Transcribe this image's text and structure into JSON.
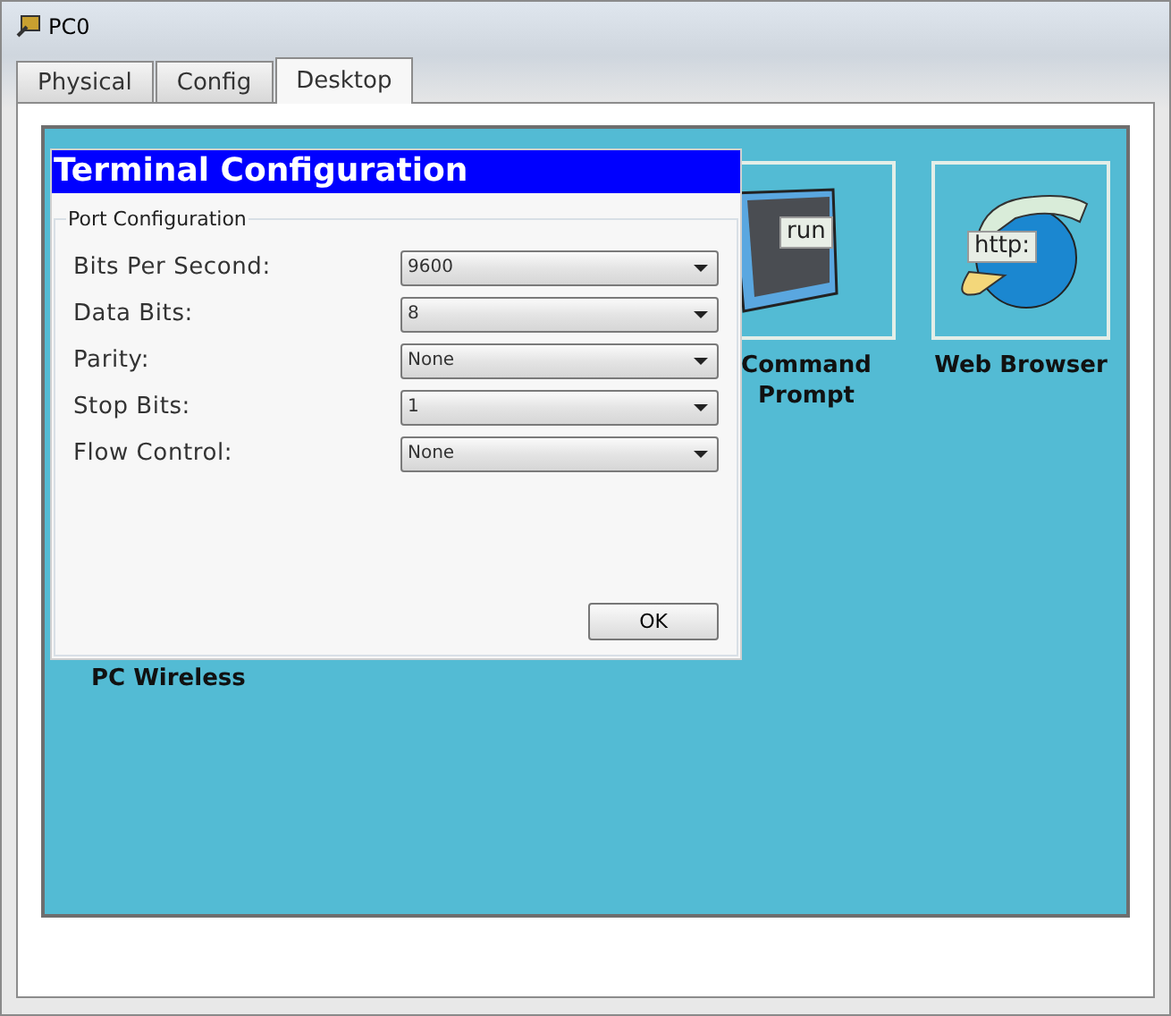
{
  "window": {
    "title": "PC0"
  },
  "tabs": [
    {
      "label": "Physical",
      "selected": false
    },
    {
      "label": "Config",
      "selected": false
    },
    {
      "label": "Desktop",
      "selected": true
    }
  ],
  "desktop": {
    "apps": [
      {
        "kind": "terminal",
        "label": "Command Prompt",
        "icon_text": "run"
      },
      {
        "kind": "browser",
        "label": "Web Browser",
        "icon_text": "http:"
      }
    ],
    "covered_app_label": "PC Wireless"
  },
  "dialog": {
    "title": "Terminal Configuration",
    "group": "Port Configuration",
    "fields": [
      {
        "label": "Bits Per Second:",
        "value": "9600"
      },
      {
        "label": "Data Bits:",
        "value": "8"
      },
      {
        "label": "Parity:",
        "value": "None"
      },
      {
        "label": "Stop Bits:",
        "value": "1"
      },
      {
        "label": "Flow Control:",
        "value": "None"
      }
    ],
    "button": "OK"
  }
}
